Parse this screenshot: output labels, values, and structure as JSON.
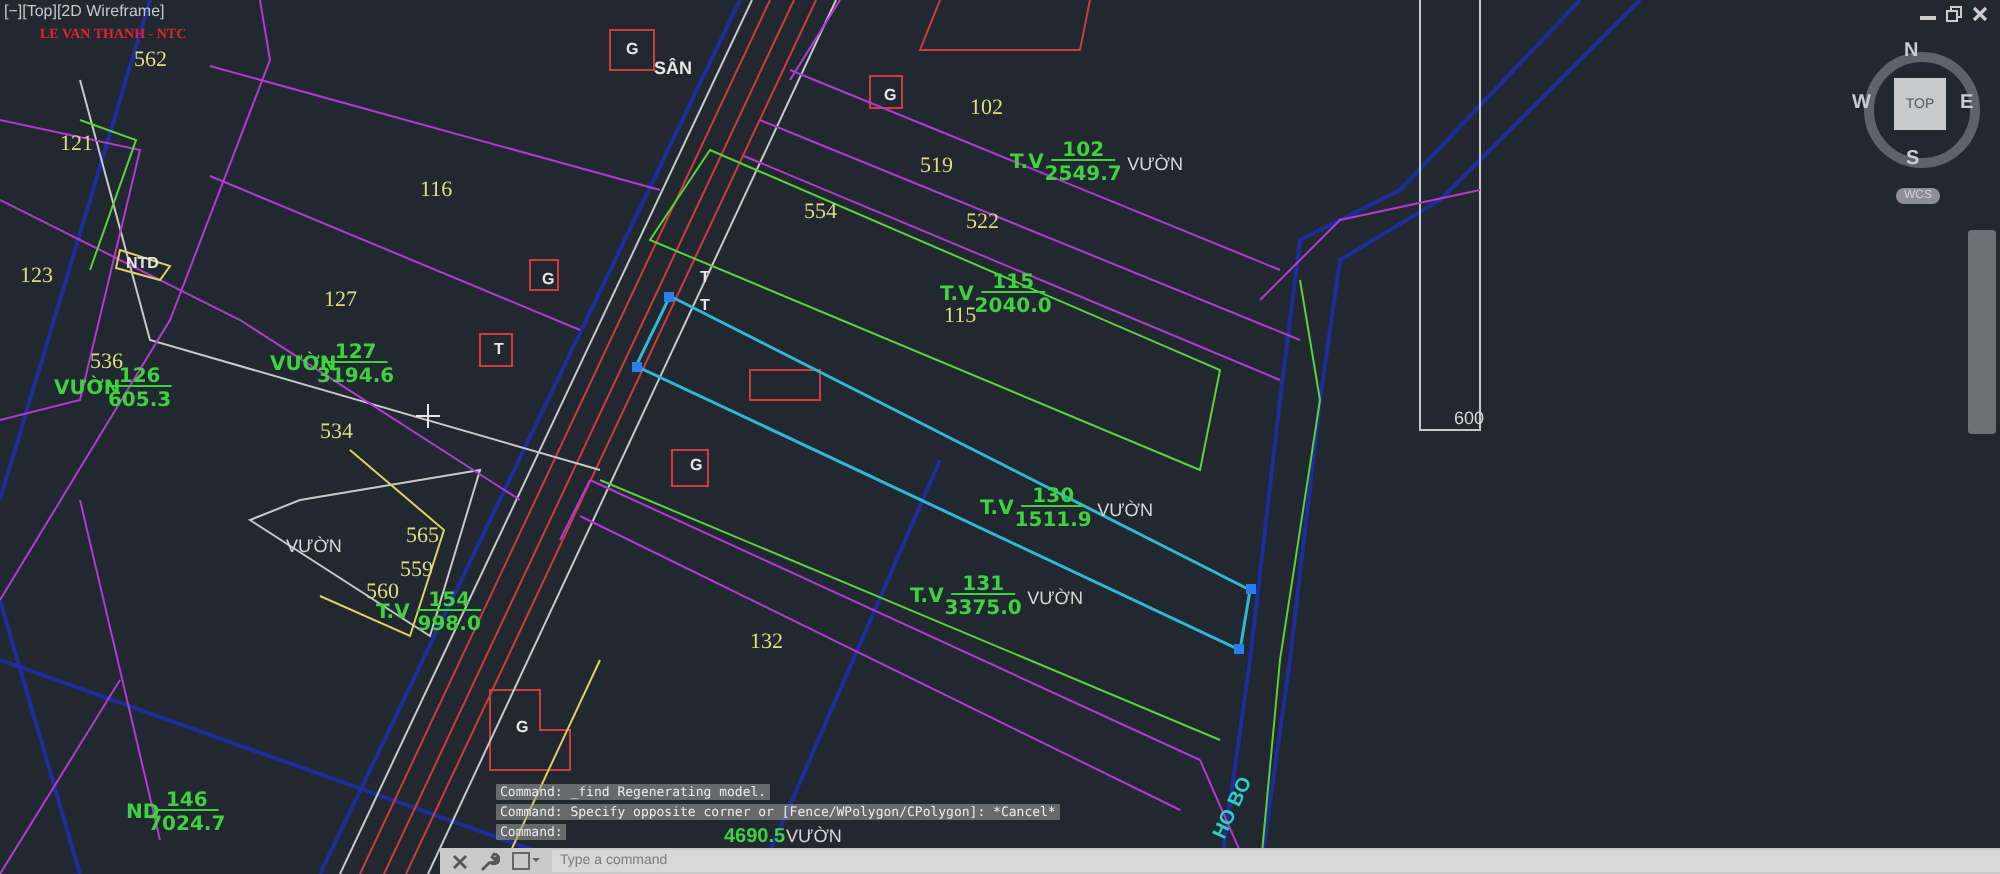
{
  "viewport_controls": "[−][Top][2D Wireframe]",
  "viewcube": {
    "north": "N",
    "west": "W",
    "east": "E",
    "south": "S",
    "face": "TOP",
    "ucs": "WCS"
  },
  "labels": [
    {
      "kind": "owner",
      "text": "LE VAN THANH - NTC"
    },
    {
      "kind": "number",
      "text": "562"
    },
    {
      "kind": "number",
      "text": "121"
    },
    {
      "kind": "number",
      "text": "123"
    },
    {
      "kind": "number",
      "text": "116"
    },
    {
      "kind": "number",
      "text": "127"
    },
    {
      "kind": "number",
      "text": "536"
    },
    {
      "kind": "number",
      "text": "534"
    },
    {
      "kind": "tag",
      "text": "NTD"
    },
    {
      "kind": "place",
      "text": "SÂN"
    },
    {
      "kind": "tag",
      "text": "G"
    },
    {
      "kind": "tag",
      "text": "G"
    },
    {
      "kind": "tag",
      "text": "T"
    },
    {
      "kind": "tag",
      "text": "G"
    },
    {
      "kind": "number",
      "text": "102"
    },
    {
      "kind": "number",
      "text": "519"
    },
    {
      "kind": "number",
      "text": "554"
    },
    {
      "kind": "number",
      "text": "522"
    },
    {
      "kind": "number",
      "text": "115"
    },
    {
      "kind": "tag",
      "text": "T"
    },
    {
      "kind": "tag",
      "text": "T"
    },
    {
      "kind": "tag",
      "text": "G"
    },
    {
      "kind": "number",
      "text": "132"
    },
    {
      "kind": "number",
      "text": "565"
    },
    {
      "kind": "number",
      "text": "559"
    },
    {
      "kind": "number",
      "text": "560"
    },
    {
      "kind": "use",
      "text": "VƯỜN"
    },
    {
      "kind": "tag",
      "text": "G"
    },
    {
      "kind": "dimension",
      "text": "600"
    },
    {
      "kind": "area",
      "text": "4690.5"
    },
    {
      "kind": "use",
      "text": "VƯỜN"
    },
    {
      "kind": "road",
      "text": "HO BO"
    }
  ],
  "fractions": [
    {
      "prefix": "T.V",
      "numerator": "102",
      "denominator": "2549.7",
      "use": "VƯỜN"
    },
    {
      "prefix": "T.V",
      "numerator": "115",
      "denominator": "2040.0"
    },
    {
      "prefix": "VƯỜN",
      "numerator": "127",
      "denominator": "3194.6"
    },
    {
      "prefix": "VƯỜN",
      "numerator": "126",
      "denominator": "605.3"
    },
    {
      "prefix": "T.V",
      "numerator": "154",
      "denominator": "998.0"
    },
    {
      "prefix": "T.V",
      "numerator": "130",
      "denominator": "1511.9",
      "use": "VƯỜN"
    },
    {
      "prefix": "T.V",
      "numerator": "131",
      "denominator": "3375.0",
      "use": "VƯỜN"
    },
    {
      "prefix": "ND",
      "numerator": "146",
      "denominator": "7024.7"
    }
  ],
  "command_history": [
    "Command:  _find Regenerating model.",
    "Command: Specify opposite corner or [Fence/WPolygon/CPolygon]: *Cancel*",
    "Command:"
  ],
  "command_input": {
    "placeholder": "Type a command"
  }
}
